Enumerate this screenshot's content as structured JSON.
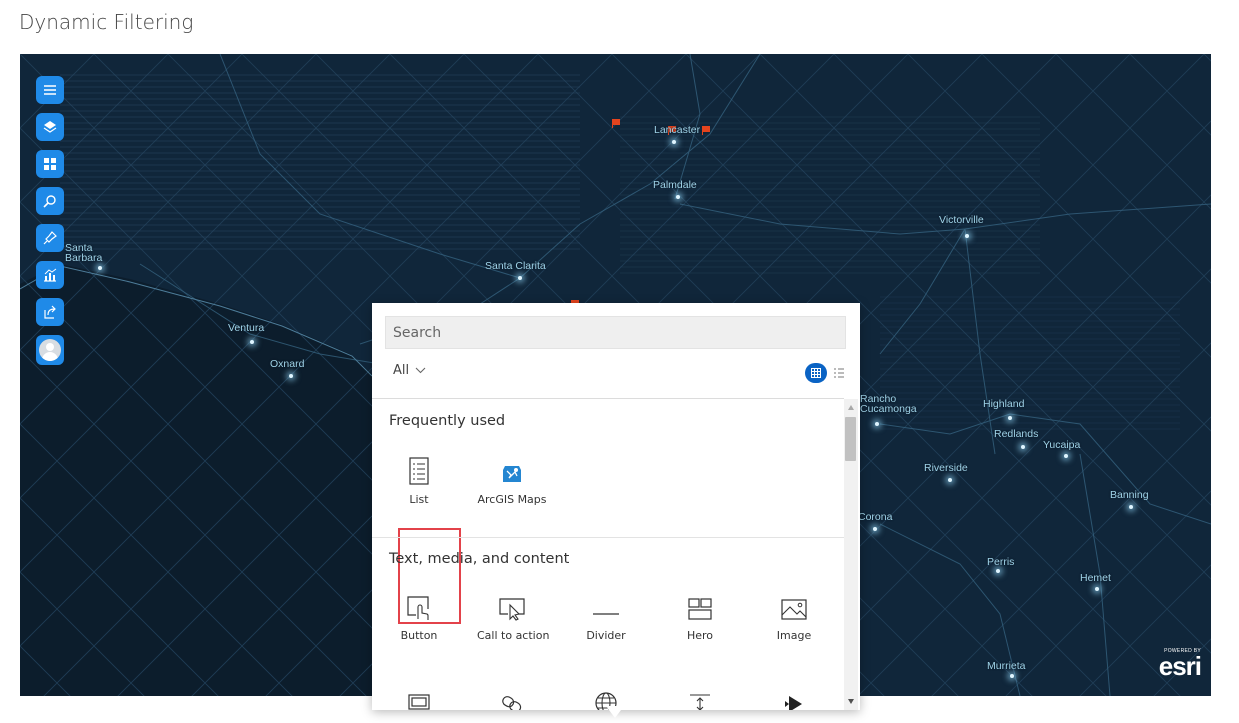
{
  "page": {
    "title": "Dynamic Filtering"
  },
  "map": {
    "cities": [
      {
        "id": "lancaster",
        "name": "Lancaster"
      },
      {
        "id": "palmdale",
        "name": "Palmdale"
      },
      {
        "id": "victorville",
        "name": "Victorville"
      },
      {
        "id": "santa-barbara",
        "name": "Santa\nBarbara"
      },
      {
        "id": "santa-clarita",
        "name": "Santa Clarita"
      },
      {
        "id": "ventura",
        "name": "Ventura"
      },
      {
        "id": "oxnard",
        "name": "Oxnard"
      },
      {
        "id": "rancho-cucamonga",
        "name": "Rancho\nCucamonga"
      },
      {
        "id": "highland",
        "name": "Highland"
      },
      {
        "id": "redlands",
        "name": "Redlands"
      },
      {
        "id": "yucaipa",
        "name": "Yucaipa"
      },
      {
        "id": "riverside",
        "name": "Riverside"
      },
      {
        "id": "banning",
        "name": "Banning"
      },
      {
        "id": "corona",
        "name": "Corona"
      },
      {
        "id": "perris",
        "name": "Perris"
      },
      {
        "id": "hemet",
        "name": "Hemet"
      },
      {
        "id": "murrieta",
        "name": "Murrieta"
      }
    ],
    "attribution": {
      "powered_by": "POWERED BY",
      "logo": "esri"
    },
    "colors": {
      "background": "#0f2234",
      "label": "#9fd3e8",
      "flag": "#e4441e",
      "toolbar": "#1f8ae8"
    }
  },
  "toolbar": {
    "items": [
      {
        "name": "menu-button",
        "icon": "hamburger-icon"
      },
      {
        "name": "layers-button",
        "icon": "layers-icon"
      },
      {
        "name": "basemap-button",
        "icon": "basemap-gallery-icon"
      },
      {
        "name": "search-button",
        "icon": "search-icon"
      },
      {
        "name": "locate-button",
        "icon": "pin-icon"
      },
      {
        "name": "analysis-button",
        "icon": "chart-icon"
      },
      {
        "name": "share-button",
        "icon": "share-icon"
      },
      {
        "name": "user-button",
        "icon": "avatar-icon"
      }
    ]
  },
  "panel": {
    "search_placeholder": "Search",
    "filter_label": "All",
    "frequently_used": {
      "title": "Frequently used",
      "items": [
        {
          "label": "List",
          "icon": "list-icon"
        },
        {
          "label": "ArcGIS Maps",
          "icon": "arcgis-maps-icon"
        }
      ]
    },
    "text_media": {
      "title": "Text, media, and content",
      "items": [
        {
          "label": "Button",
          "icon": "button-icon"
        },
        {
          "label": "Call to action",
          "icon": "call-to-action-icon"
        },
        {
          "label": "Divider",
          "icon": "divider-icon"
        },
        {
          "label": "Hero",
          "icon": "hero-icon"
        },
        {
          "label": "Image",
          "icon": "image-icon"
        }
      ],
      "next_row_icons": [
        "slideshow-icon",
        "link-icon",
        "globe-icon",
        "spacer-icon",
        "play-icon"
      ]
    }
  }
}
